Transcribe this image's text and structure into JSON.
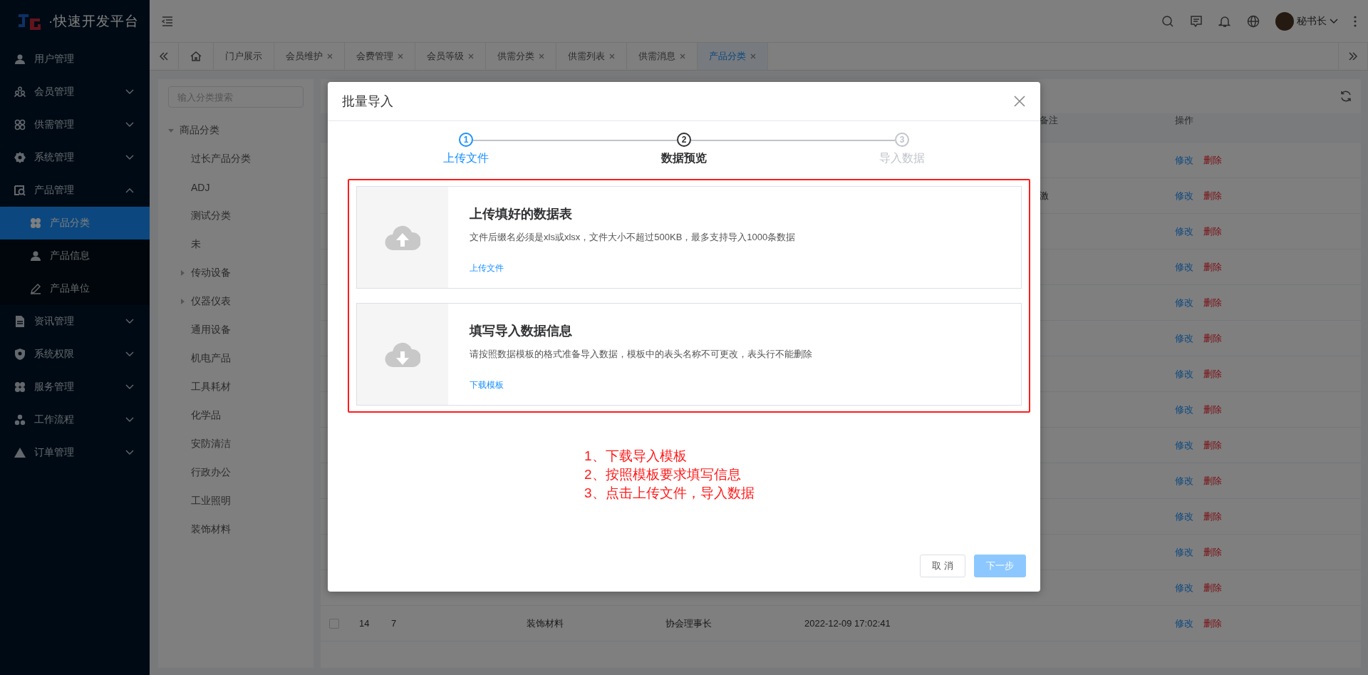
{
  "brand": {
    "title": "·快速开发平台"
  },
  "header": {
    "user": "秘书长"
  },
  "sidebar": {
    "items": [
      {
        "label": "用户管理"
      },
      {
        "label": "会员管理",
        "expanded": false
      },
      {
        "label": "供需管理",
        "expanded": false
      },
      {
        "label": "系统管理",
        "expanded": false
      },
      {
        "label": "产品管理",
        "expanded": true,
        "children": [
          {
            "label": "产品分类",
            "selected": true
          },
          {
            "label": "产品信息",
            "selected": false
          },
          {
            "label": "产品单位",
            "selected": false
          }
        ]
      },
      {
        "label": "资讯管理",
        "expanded": false
      },
      {
        "label": "系统权限",
        "expanded": false
      },
      {
        "label": "服务管理",
        "expanded": false
      },
      {
        "label": "工作流程",
        "expanded": false
      },
      {
        "label": "订单管理",
        "expanded": false
      }
    ]
  },
  "tabs": [
    {
      "label": "门户展示",
      "closable": false,
      "selected": false
    },
    {
      "label": "会员维护",
      "closable": true,
      "selected": false
    },
    {
      "label": "会费管理",
      "closable": true,
      "selected": false
    },
    {
      "label": "会员等级",
      "closable": true,
      "selected": false
    },
    {
      "label": "供需分类",
      "closable": true,
      "selected": false
    },
    {
      "label": "供需列表",
      "closable": true,
      "selected": false
    },
    {
      "label": "供需消息",
      "closable": true,
      "selected": false
    },
    {
      "label": "产品分类",
      "closable": true,
      "selected": true
    }
  ],
  "tree": {
    "search_placeholder": "输入分类搜索",
    "root": {
      "label": "商品分类",
      "expanded": true,
      "children": [
        {
          "label": "过长产品分类"
        },
        {
          "label": "ADJ"
        },
        {
          "label": "测试分类"
        },
        {
          "label": "未"
        },
        {
          "label": "传动设备",
          "expanded": false
        },
        {
          "label": "仪器仪表",
          "expanded": false
        },
        {
          "label": "通用设备"
        },
        {
          "label": "机电产品"
        },
        {
          "label": "工具耗材"
        },
        {
          "label": "化学品"
        },
        {
          "label": "安防清洁"
        },
        {
          "label": "行政办公"
        },
        {
          "label": "工业照明"
        },
        {
          "label": "装饰材料"
        }
      ]
    }
  },
  "table": {
    "columns": [
      "备注",
      "操作"
    ],
    "rows": [
      {
        "actions": [
          "修改",
          "删除"
        ]
      },
      {
        "remark": "激",
        "actions": [
          "修改",
          "删除"
        ]
      },
      {
        "actions": [
          "修改",
          "删除"
        ]
      },
      {
        "actions": [
          "修改",
          "删除"
        ]
      },
      {
        "actions": [
          "修改",
          "删除"
        ]
      },
      {
        "actions": [
          "修改",
          "删除"
        ]
      },
      {
        "actions": [
          "修改",
          "删除"
        ]
      },
      {
        "actions": [
          "修改",
          "删除"
        ]
      },
      {
        "actions": [
          "修改",
          "删除"
        ]
      },
      {
        "actions": [
          "修改",
          "删除"
        ]
      },
      {
        "actions": [
          "修改",
          "删除"
        ]
      },
      {
        "actions": [
          "修改",
          "删除"
        ]
      },
      {
        "actions": [
          "修改",
          "删除"
        ]
      },
      {
        "checked": false,
        "cells": [
          "14",
          "7",
          "装饰材料",
          "协会理事长",
          "2022-12-09 17:02:41"
        ],
        "actions": [
          "修改",
          "删除"
        ]
      }
    ]
  },
  "dialog": {
    "title": "批量导入",
    "steps": [
      {
        "number": "1",
        "label": "上传文件",
        "finished": true,
        "selected": false
      },
      {
        "number": "2",
        "label": "数据预览",
        "finished": false,
        "selected": true
      },
      {
        "number": "3",
        "label": "导入数据",
        "finished": false,
        "selected": false
      }
    ],
    "cards": [
      {
        "kind": "upload",
        "title": "上传填好的数据表",
        "description": "文件后缀名必须是xls或xlsx，文件大小不超过500KB，最多支持导入1000条数据",
        "link": "上传文件"
      },
      {
        "kind": "download",
        "title": "填写导入数据信息",
        "description": "请按照数据模板的格式准备导入数据，模板中的表头名称不可更改，表头行不能删除",
        "link": "下载模板"
      }
    ],
    "instructions": [
      "1、下载导入模板",
      "2、按照模板要求填写信息",
      "3、点击上传文件，导入数据"
    ],
    "buttons": [
      {
        "label": "取 消",
        "kind": "default",
        "disabled": false
      },
      {
        "label": "下一步",
        "kind": "primary",
        "disabled": true
      }
    ]
  }
}
